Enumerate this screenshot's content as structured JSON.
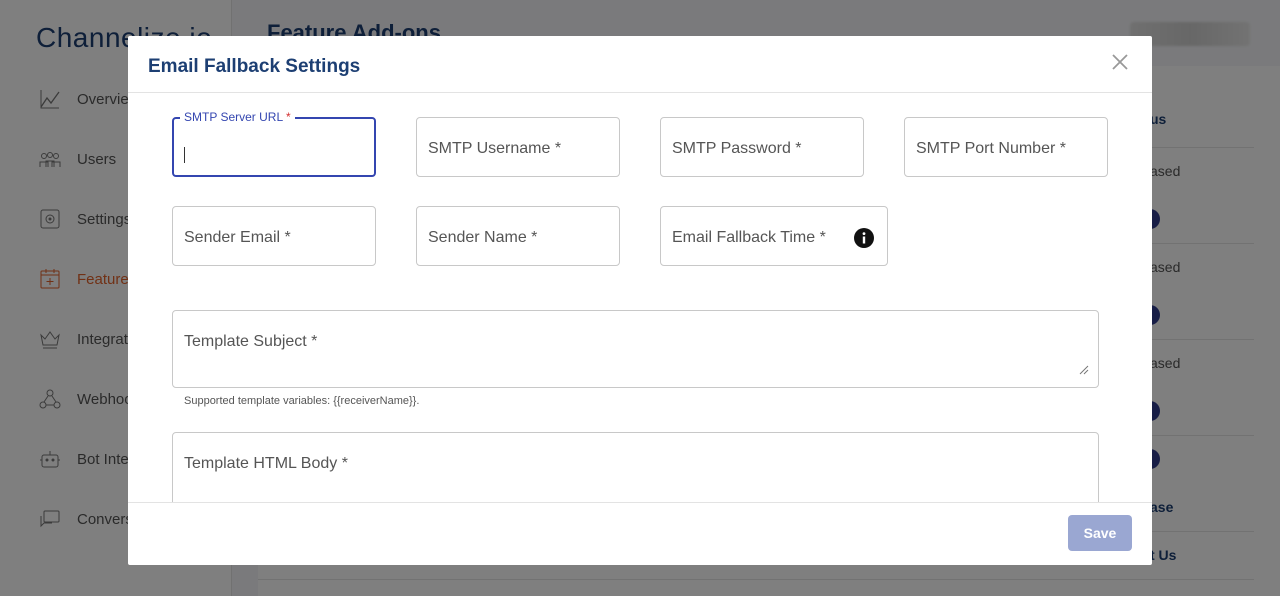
{
  "app": {
    "logo": "Channelize.io",
    "page_title": "Feature Add-ons",
    "nav": [
      {
        "label": "Overview",
        "icon": "chart-line-icon"
      },
      {
        "label": "Users",
        "icon": "users-icon"
      },
      {
        "label": "Settings",
        "icon": "gear-icon"
      },
      {
        "label": "Features",
        "icon": "calendar-plus-icon"
      },
      {
        "label": "Integrations",
        "icon": "crown-icon"
      },
      {
        "label": "Webhooks",
        "icon": "webhook-icon"
      },
      {
        "label": "Bot Integrations",
        "icon": "robot-icon"
      },
      {
        "label": "Conversations",
        "icon": "chat-icon"
      }
    ],
    "table_right_column": [
      "us",
      "ased",
      "ased",
      "ased",
      "ase",
      "t Us"
    ]
  },
  "modal": {
    "title": "Email Fallback Settings",
    "fields": {
      "smtp_server_url": {
        "label": "SMTP Server URL",
        "required_mark": "*",
        "value": ""
      },
      "smtp_username": {
        "label": "SMTP Username *"
      },
      "smtp_password": {
        "label": "SMTP Password *"
      },
      "smtp_port": {
        "label": "SMTP Port Number *"
      },
      "sender_email": {
        "label": "Sender Email *"
      },
      "sender_name": {
        "label": "Sender Name *"
      },
      "fallback_time": {
        "label": "Email Fallback Time *",
        "icon": "info-icon"
      },
      "template_subject": {
        "label": "Template Subject *",
        "helper": "Supported template variables: {{receiverName}}."
      },
      "template_html_body": {
        "label": "Template HTML Body *"
      }
    },
    "save_label": "Save"
  },
  "colors": {
    "brand": "#1d3f73",
    "accent": "#3446b0",
    "active_nav": "#e2622b",
    "save_disabled": "#9aa7d2"
  }
}
